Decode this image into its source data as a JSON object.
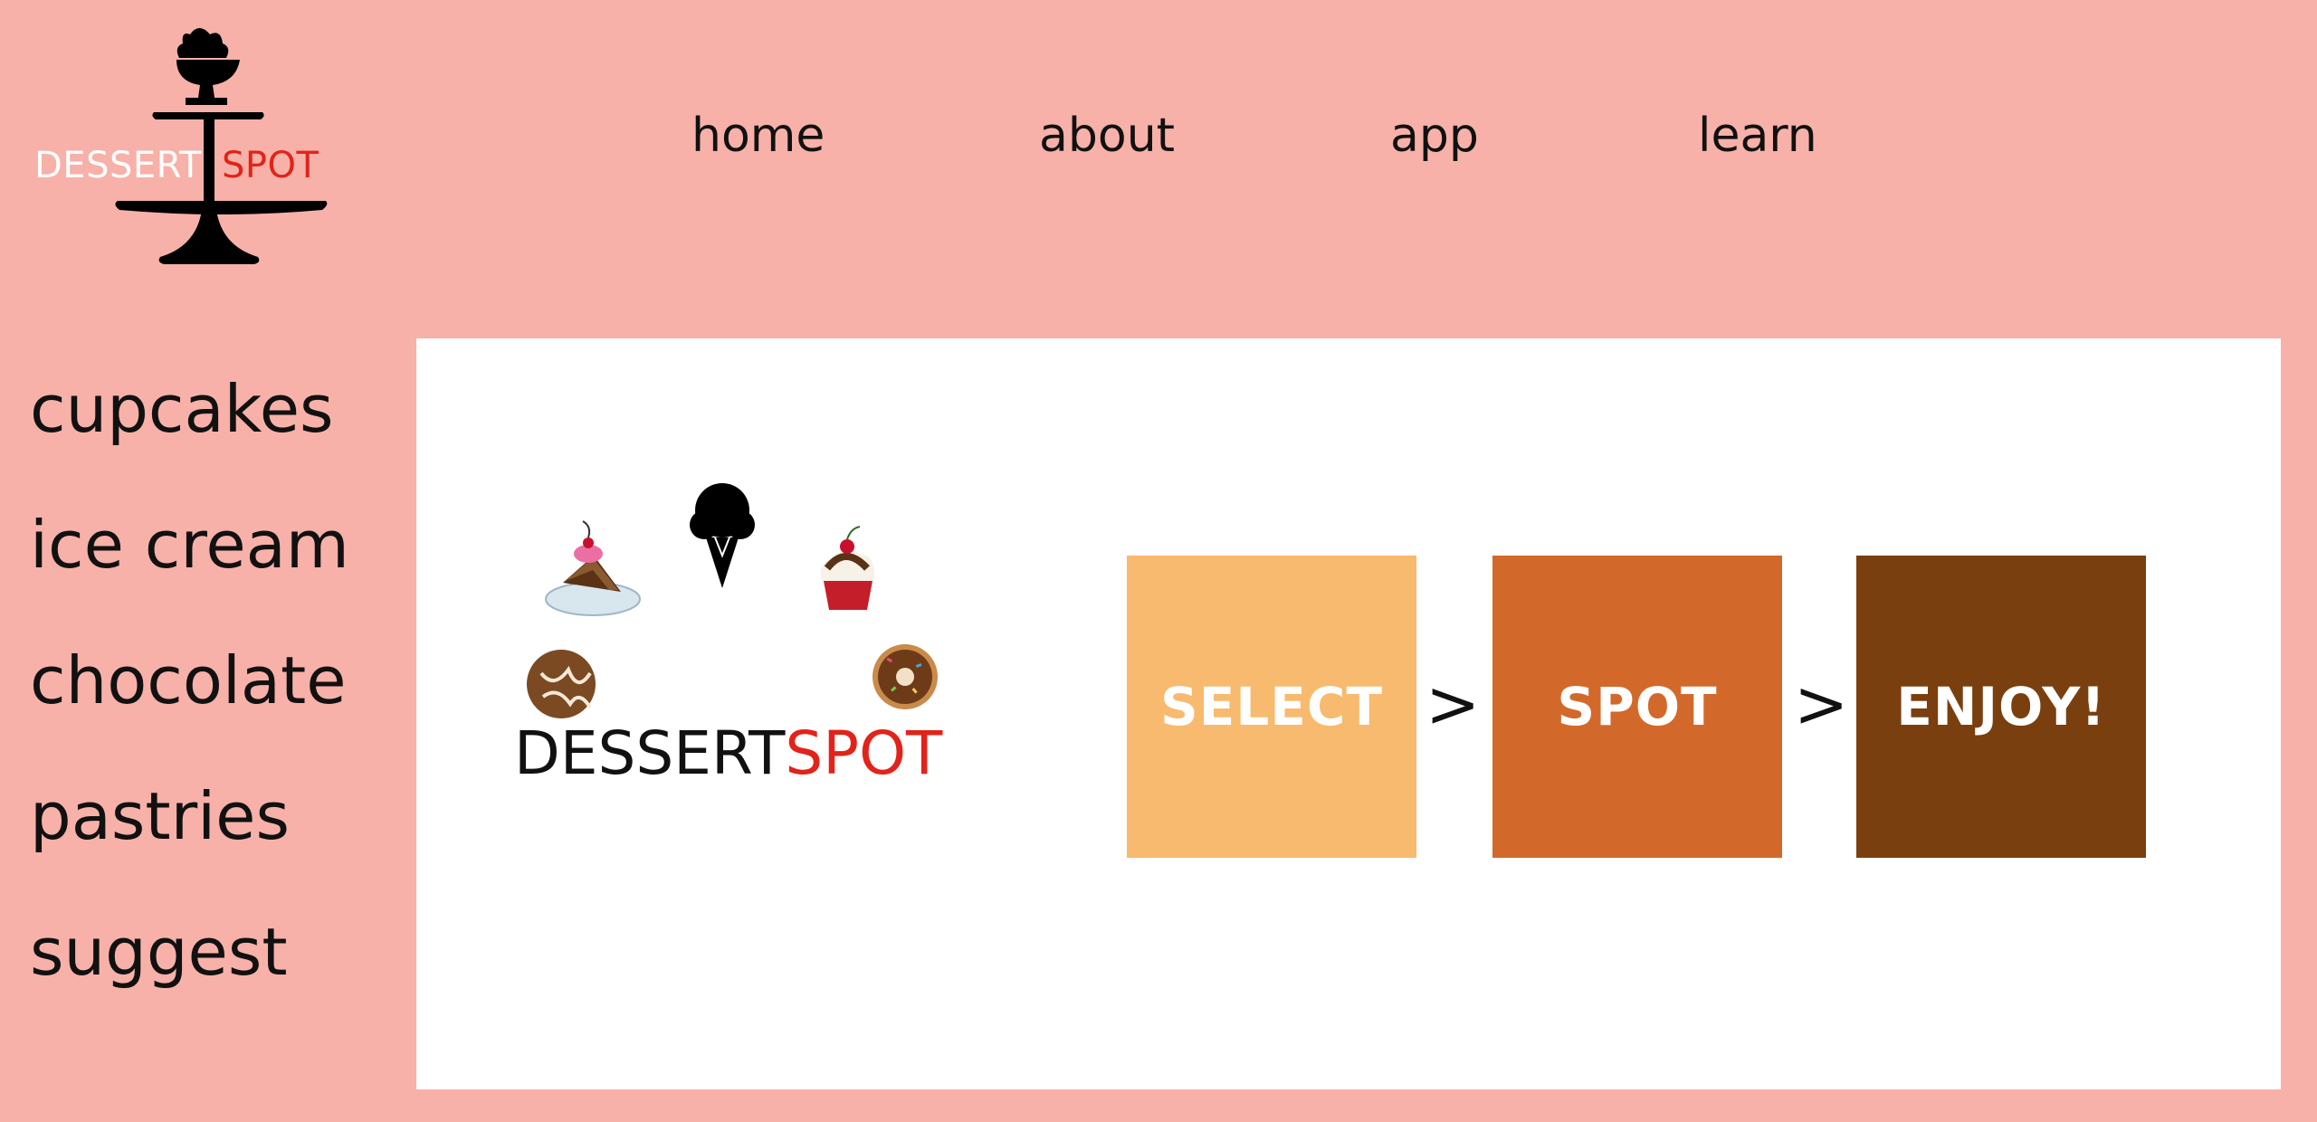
{
  "logo": {
    "word1": "DESSERT",
    "word2": "SPOT"
  },
  "nav": [
    {
      "label": "home"
    },
    {
      "label": "about"
    },
    {
      "label": "app"
    },
    {
      "label": "learn"
    }
  ],
  "sidebar": [
    {
      "label": "cupcakes"
    },
    {
      "label": "ice cream"
    },
    {
      "label": "chocolate"
    },
    {
      "label": "pastries"
    },
    {
      "label": "suggest"
    }
  ],
  "hero": {
    "brand_part1": "DESSERT",
    "brand_part2": "SPOT",
    "steps": [
      "SELECT",
      "SPOT",
      "ENJOY!"
    ],
    "separator": ">"
  },
  "colors": {
    "background": "#F7B1A8",
    "brand_red": "#E2231A",
    "step_select": "#F7BA6E",
    "step_spot": "#D2692B",
    "step_enjoy": "#7A3F0E"
  }
}
